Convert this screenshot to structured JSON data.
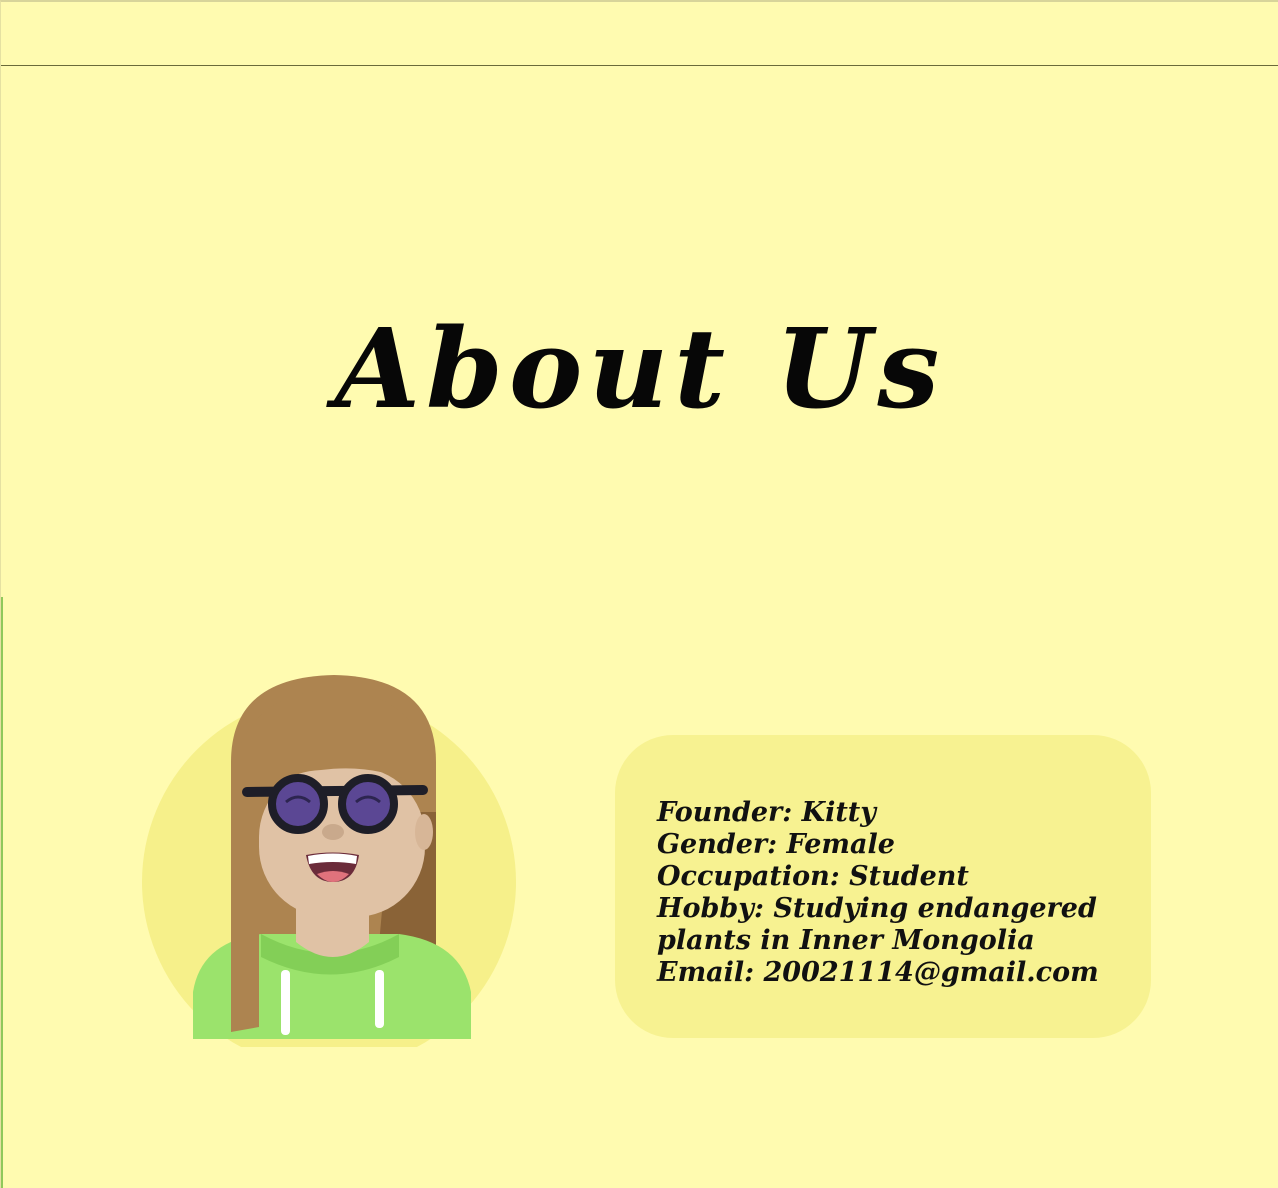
{
  "title": "About Us",
  "profile": {
    "founder": "Founder: Kitty",
    "gender": "Gender: Female",
    "occupation": "Occupation: Student",
    "hobby_line1": "Hobby: Studying endangered",
    "hobby_line2": "plants in Inner Mongolia",
    "email": "Email: 20021114@gmail.com"
  },
  "colors": {
    "background": "#fffbb0",
    "card": "#f7f291",
    "accent_green": "#9be36c"
  },
  "icons": {
    "avatar": "founder-avatar-illustration"
  }
}
